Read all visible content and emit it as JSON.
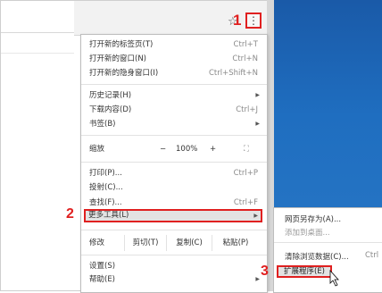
{
  "menu": {
    "new_tab": {
      "label": "打开新的标签页(T)",
      "shortcut": "Ctrl+T"
    },
    "new_window": {
      "label": "打开新的窗口(N)",
      "shortcut": "Ctrl+N"
    },
    "incognito": {
      "label": "打开新的隐身窗口(I)",
      "shortcut": "Ctrl+Shift+N"
    },
    "history": {
      "label": "历史记录(H)"
    },
    "downloads": {
      "label": "下载内容(D)",
      "shortcut": "Ctrl+J"
    },
    "bookmarks": {
      "label": "书签(B)"
    },
    "zoom": {
      "label": "缩放",
      "minus": "−",
      "value": "100%",
      "plus": "+",
      "fullscreen": "⛶"
    },
    "print": {
      "label": "打印(P)...",
      "shortcut": "Ctrl+P"
    },
    "cast": {
      "label": "投射(C)..."
    },
    "find": {
      "label": "查找(F)...",
      "shortcut": "Ctrl+F"
    },
    "more_tools": {
      "label": "更多工具(L)"
    },
    "edit": {
      "label": "修改",
      "cut": "剪切(T)",
      "copy": "复制(C)",
      "paste": "粘贴(P)"
    },
    "settings": {
      "label": "设置(S)"
    },
    "help": {
      "label": "帮助(E)"
    }
  },
  "submenu": {
    "save_page": "网页另存为(A)...",
    "add_to_desktop": "添加到桌面...",
    "clear_data": "清除浏览数据(C)...",
    "clear_shortcut": "Ctrl",
    "extensions": "扩展程序(E)"
  },
  "steps": {
    "one": "1",
    "two": "2",
    "three": "3"
  },
  "colors": {
    "annotation": "#e02020",
    "desktop": "#1f6ec0",
    "highlight": "#e3e3e3"
  },
  "icons": {
    "bookmark_star": "star-icon",
    "menu": "kebab-menu-icon",
    "cursor": "mouse-cursor-icon"
  }
}
